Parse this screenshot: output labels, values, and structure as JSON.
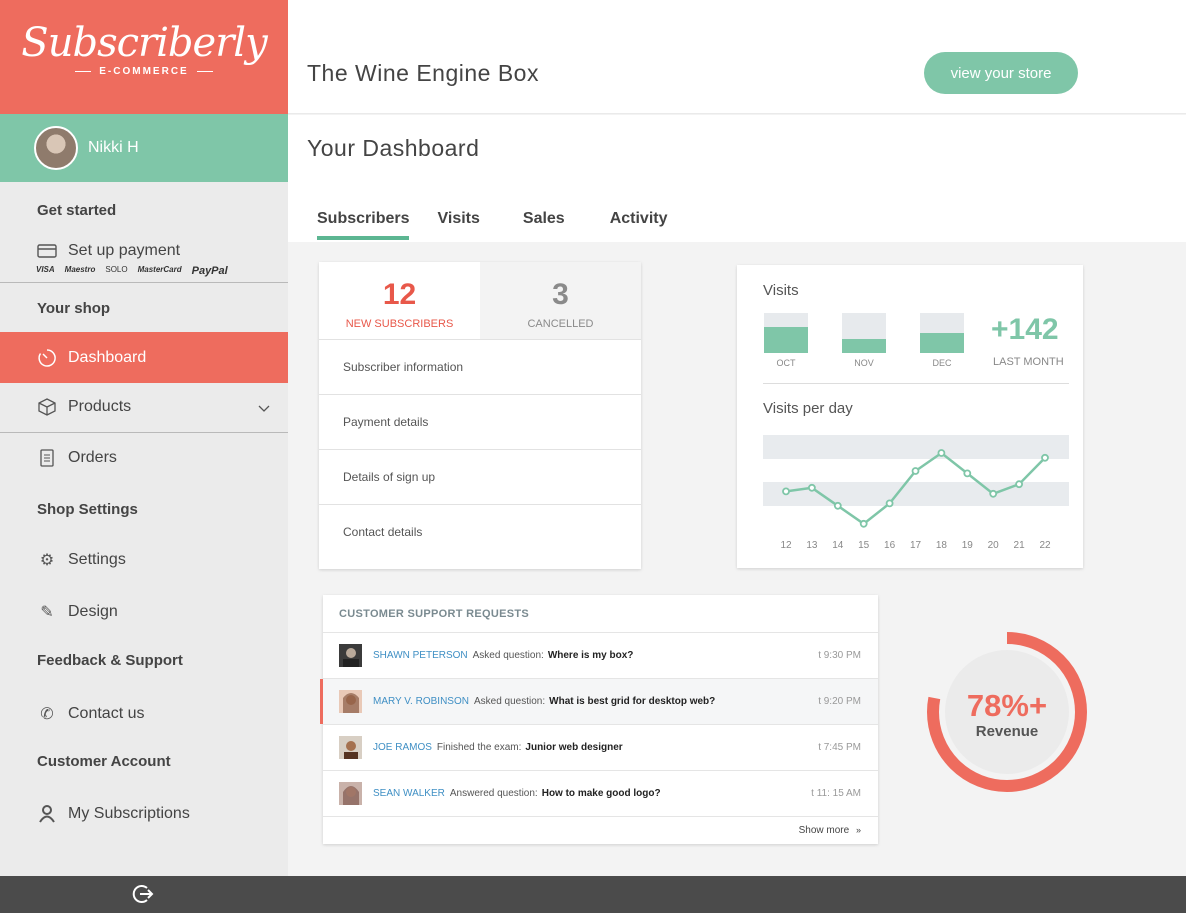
{
  "brand": {
    "name": "Subscriberly",
    "tagline": "E-COMMERCE",
    "accent": "#ee6c5e",
    "green": "#7fc6a8"
  },
  "user": {
    "name": "Nikki H"
  },
  "sidebar": {
    "get_started": "Get started",
    "setup_payment": "Set up payment",
    "payment_logos": [
      "VISA",
      "Maestro",
      "SOLO",
      "MasterCard",
      "PayPal"
    ],
    "your_shop": "Your shop",
    "dashboard": "Dashboard",
    "products": "Products",
    "orders": "Orders",
    "shop_settings": "Shop Settings",
    "settings": "Settings",
    "design": "Design",
    "feedback": "Feedback & Support",
    "contact": "Contact us",
    "customer_account": "Customer Account",
    "subscriptions": "My Subscriptions"
  },
  "header": {
    "store_title": "The Wine Engine Box",
    "store_button": "view your store"
  },
  "dashboard": {
    "title": "Your Dashboard",
    "tabs": [
      "Subscribers",
      "Visits",
      "Sales",
      "Activity"
    ]
  },
  "subscribers": {
    "new_count": "12",
    "new_label": "NEW SUBSCRIBERS",
    "cancel_count": "3",
    "cancel_label": "CANCELLED",
    "rows": [
      "Subscriber information",
      "Payment details",
      "Details of sign up",
      "Contact details"
    ]
  },
  "visits": {
    "title": "Visits",
    "months": [
      {
        "label": "OCT",
        "fill": 0.65
      },
      {
        "label": "NOV",
        "fill": 0.35
      },
      {
        "label": "DEC",
        "fill": 0.5
      }
    ],
    "delta": "+142",
    "delta_label": "LAST MONTH",
    "per_day_title": "Visits per day"
  },
  "chart_data": {
    "type": "line",
    "title": "Visits per day",
    "x": [
      "12",
      "13",
      "14",
      "15",
      "16",
      "17",
      "18",
      "19",
      "20",
      "21",
      "22"
    ],
    "series": [
      {
        "values": [
          48,
          51,
          36,
          21,
          38,
          65,
          80,
          63,
          46,
          54,
          76
        ]
      }
    ],
    "ylim": [
      0,
      100
    ]
  },
  "support": {
    "title": "CUSTOMER SUPPORT REQUESTS",
    "rows": [
      {
        "name": "SHAWN PETERSON",
        "action": "Asked question:",
        "subject": "Where is my box?",
        "time": "t 9:30 PM"
      },
      {
        "name": "MARY V. ROBINSON",
        "action": "Asked question:",
        "subject": "What is best grid for desktop web?",
        "time": "t 9:20 PM"
      },
      {
        "name": "JOE RAMOS",
        "action": "Finished the exam:",
        "subject": "Junior web designer",
        "time": "t 7:45 PM"
      },
      {
        "name": "SEAN WALKER",
        "action": "Answered question:",
        "subject": "How to make good logo?",
        "time": "t 11: 15 AM"
      }
    ],
    "show_more": "Show more"
  },
  "revenue": {
    "percent": "78%+",
    "label": "Revenue",
    "progress": 0.78
  }
}
